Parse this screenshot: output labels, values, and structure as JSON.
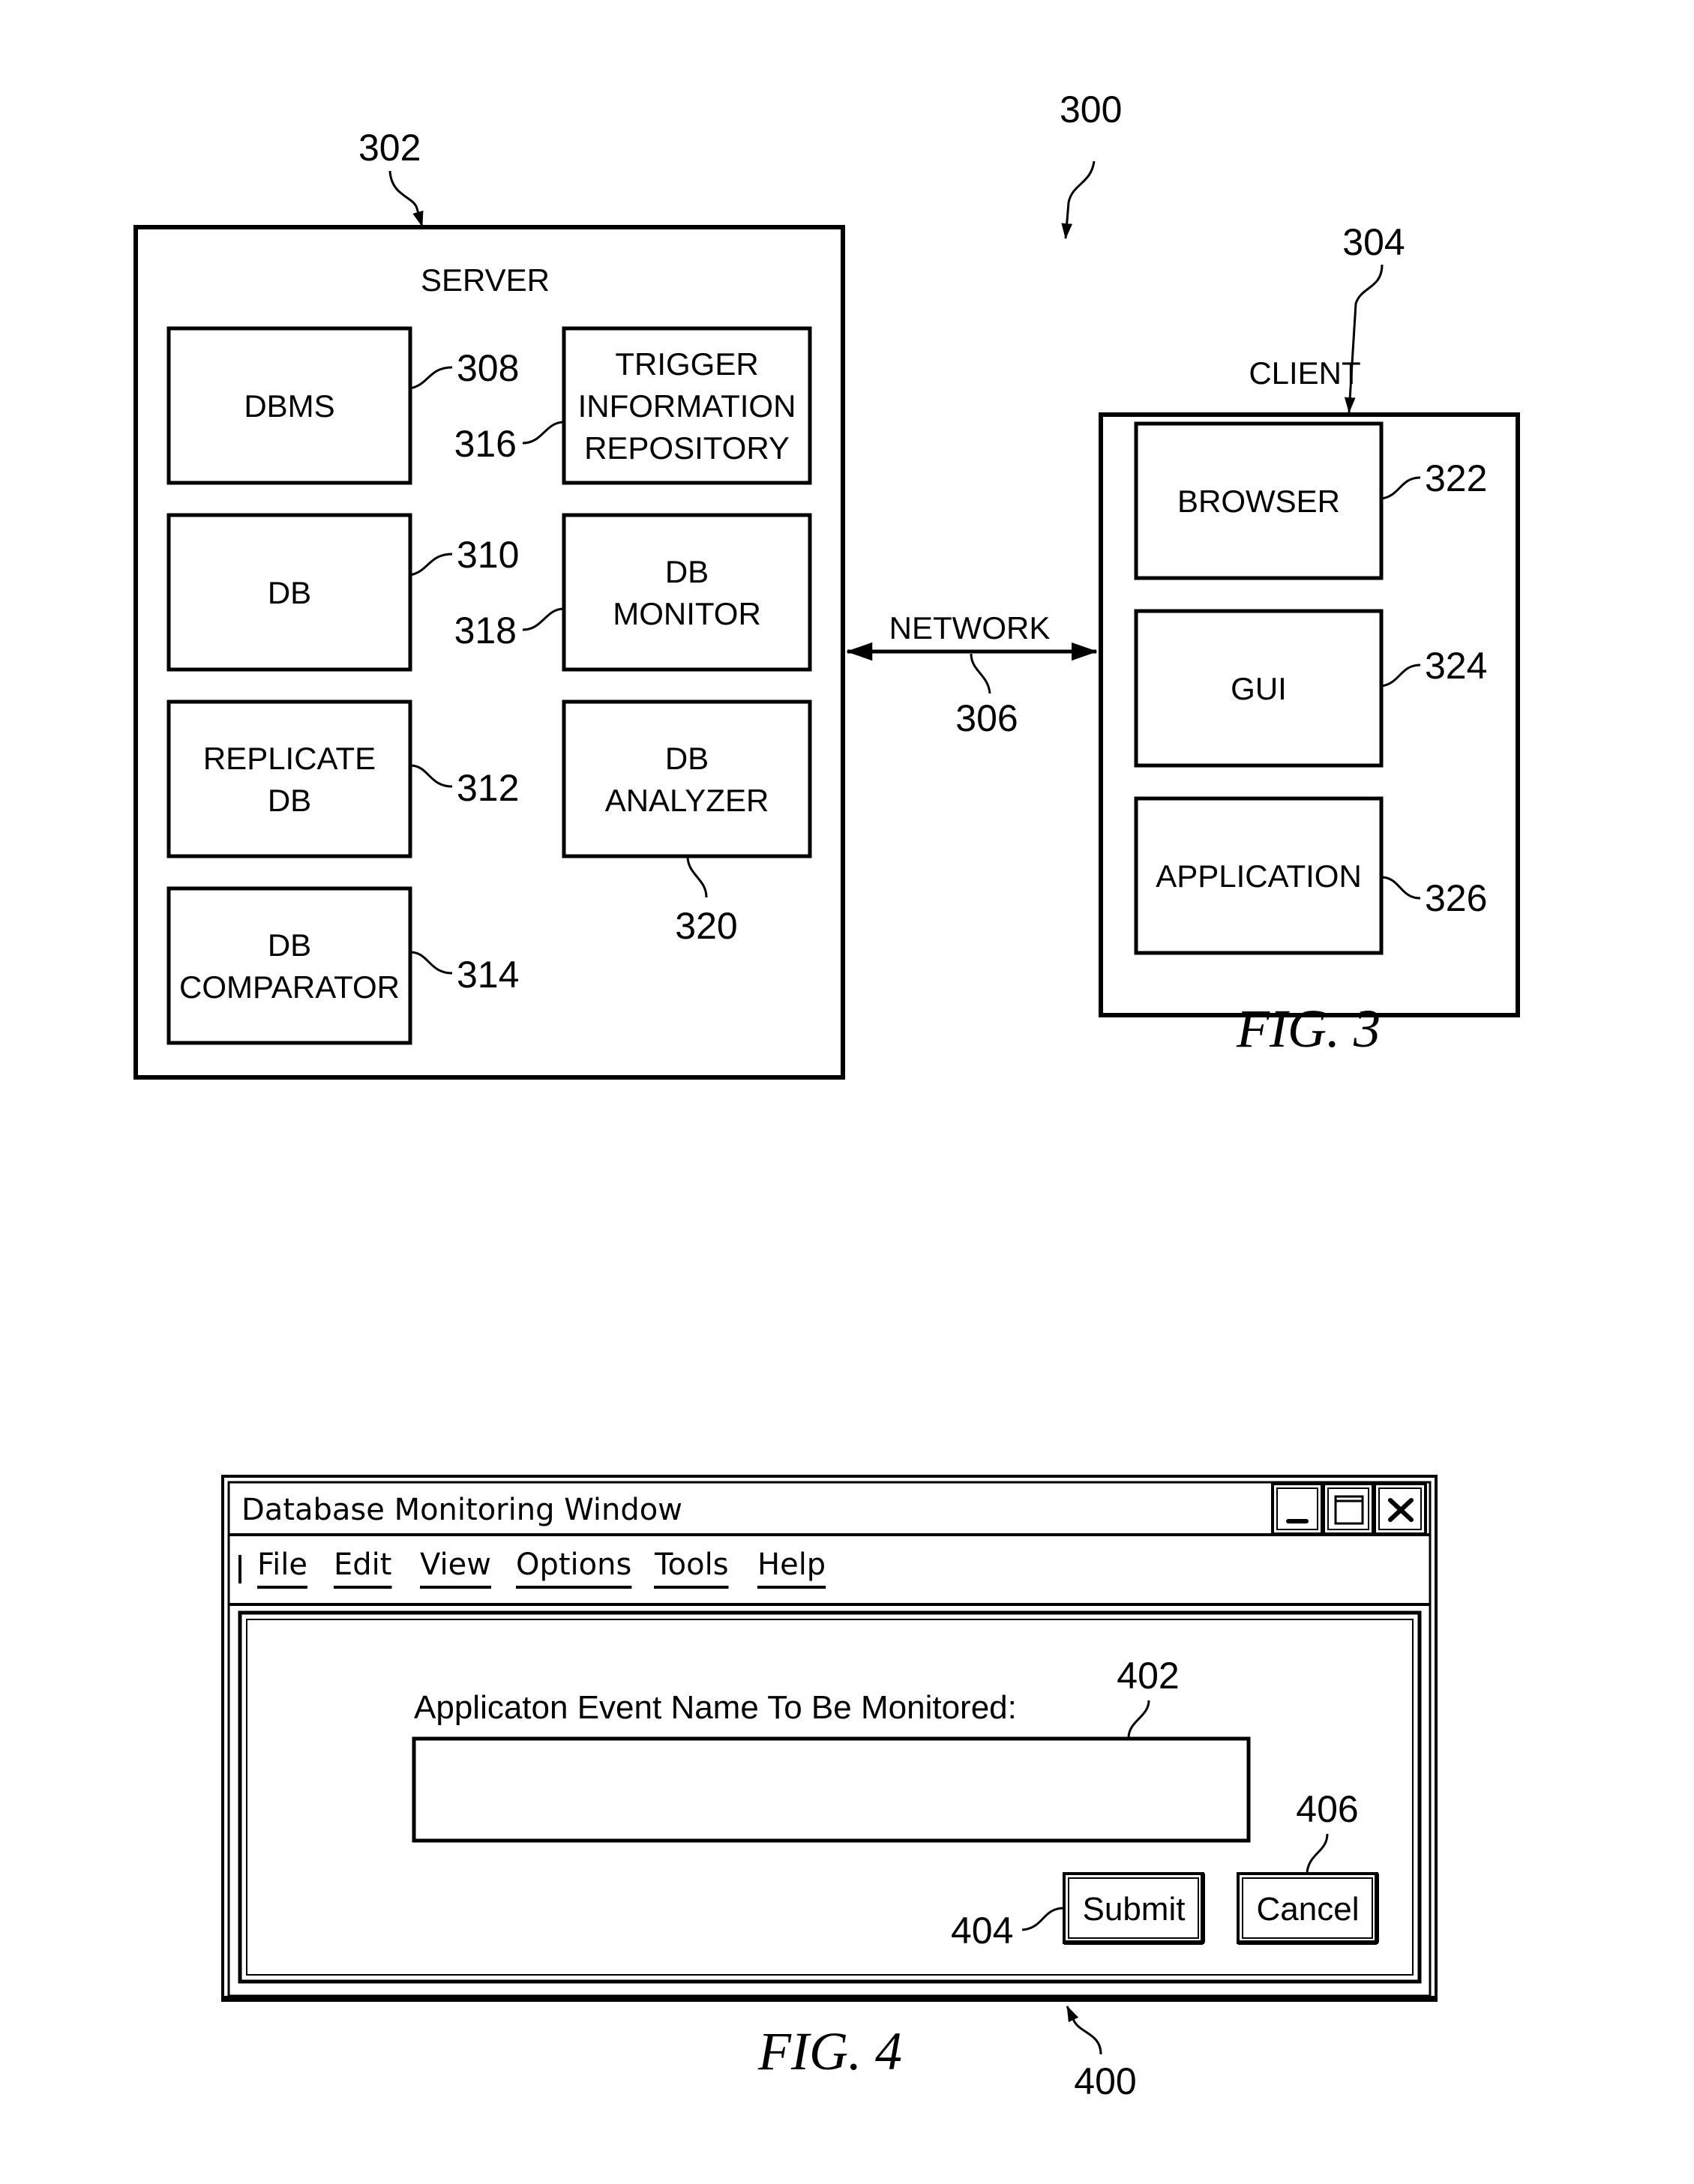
{
  "fig3": {
    "caption": "FIG. 3",
    "system_ref": "300",
    "server": {
      "ref": "302",
      "title": "SERVER",
      "left_column": [
        {
          "ref": "308",
          "lines": [
            "DBMS"
          ]
        },
        {
          "ref": "310",
          "lines": [
            "DB"
          ]
        },
        {
          "ref": "312",
          "lines": [
            "REPLICATE",
            "DB"
          ]
        },
        {
          "ref": "314",
          "lines": [
            "DB",
            "COMPARATOR"
          ]
        }
      ],
      "right_column": [
        {
          "ref": "316",
          "lines": [
            "TRIGGER",
            "INFORMATION",
            "REPOSITORY"
          ]
        },
        {
          "ref": "318",
          "lines": [
            "DB",
            "MONITOR"
          ]
        },
        {
          "ref": "320",
          "lines": [
            "DB",
            "ANALYZER"
          ]
        }
      ]
    },
    "network": {
      "ref": "306",
      "label": "NETWORK"
    },
    "client": {
      "ref": "304",
      "title": "CLIENT",
      "items": [
        {
          "ref": "322",
          "lines": [
            "BROWSER"
          ]
        },
        {
          "ref": "324",
          "lines": [
            "GUI"
          ]
        },
        {
          "ref": "326",
          "lines": [
            "APPLICATION"
          ]
        }
      ]
    }
  },
  "fig4": {
    "caption": "FIG. 4",
    "window_ref": "400",
    "window": {
      "title": "Database Monitoring Window",
      "controls": [
        "minimize-icon",
        "maximize-icon",
        "close-icon"
      ],
      "menu": [
        "File",
        "Edit",
        "View",
        "Options",
        "Tools",
        "Help"
      ],
      "field_label": "Applicaton Event Name To Be Monitored:",
      "field_value": "",
      "field_ref": "402",
      "submit_label": "Submit",
      "submit_ref": "404",
      "cancel_label": "Cancel",
      "cancel_ref": "406"
    }
  }
}
